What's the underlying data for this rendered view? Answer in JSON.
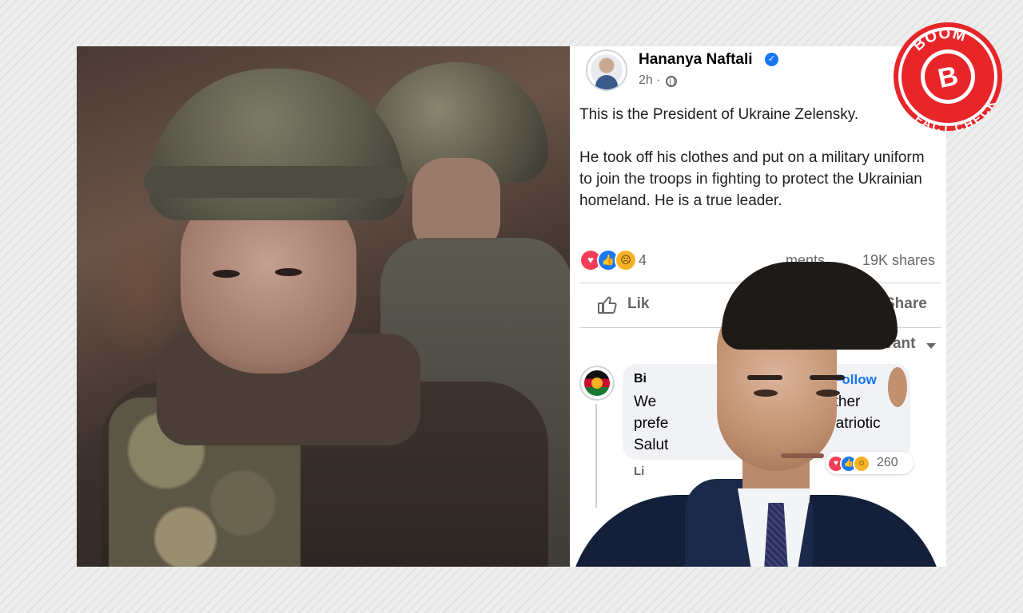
{
  "post": {
    "author": "Hananya Naftali",
    "time": "2h ·",
    "paragraph1": "This is the President of Ukraine Zelensky.",
    "paragraph2": "He took off his clothes and put on a military uniform to join the troops in fighting to protect the Ukrainian homeland. He is a true leader.",
    "reaction_count_partial": "4",
    "comments_partial": "ments",
    "shares": "19K shares",
    "like_label_partial": "Lik",
    "share_label": "Share",
    "sort_label": "Most relevant"
  },
  "comment": {
    "author_partial": "Bi",
    "dot": "·",
    "follow_label": "Follow",
    "line1_left": "We",
    "line1_right": "He rather",
    "line2_left": "prefe",
    "line2_right": "ee. Patriotic",
    "line3_left": "Salut",
    "reaction_count": "260",
    "like_partial": "Li"
  },
  "badge": {
    "top_text": "BOOM",
    "letter": "B",
    "bottom_text": "FACT CHECK",
    "color": "#e8262a"
  },
  "icons": {
    "verified": "verified-badge-icon",
    "globe": "globe-icon",
    "like": "thumbs-up-icon",
    "share": "share-arrow-icon",
    "sort": "chevron-down-icon"
  },
  "colors": {
    "facebook_blue": "#1877f2",
    "love": "#f33e58",
    "sad": "#f7b125",
    "muted_text": "#65676b"
  }
}
